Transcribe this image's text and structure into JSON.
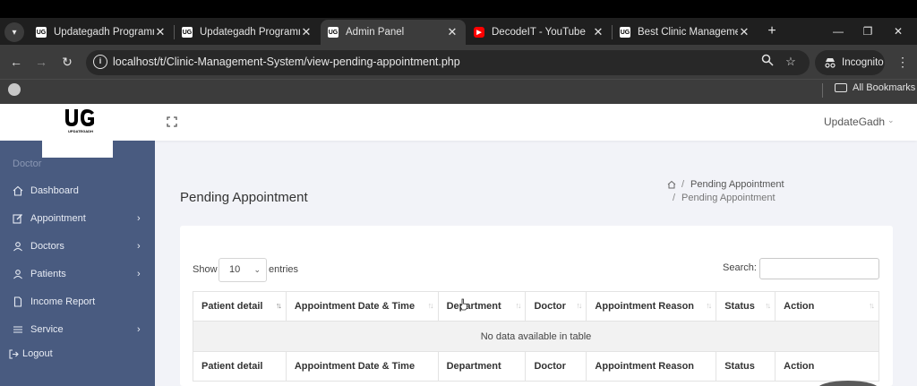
{
  "browser": {
    "tabs": [
      {
        "title": "Updategadh Programmin",
        "favicon": "UG",
        "active": false
      },
      {
        "title": "Updategadh Programmin",
        "favicon": "UG",
        "active": false
      },
      {
        "title": "Admin Panel",
        "favicon": "UG",
        "active": true
      },
      {
        "title": "DecodeIT - YouTube",
        "favicon": "youtube-icon",
        "active": false
      },
      {
        "title": "Best Clinic Management",
        "favicon": "UG",
        "active": false
      }
    ],
    "url": "localhost/t/Clinic-Management-System/view-pending-appointment.php",
    "incognito_label": "Incognito",
    "bookmarks_label": "All Bookmarks"
  },
  "app": {
    "logo_text": "UG",
    "logo_sub": "UPDATEGADH",
    "user_name": "UpdateGadh"
  },
  "sidebar": {
    "heading": "Doctor",
    "items": [
      {
        "label": "Dashboard",
        "icon": "home-icon",
        "has_submenu": false
      },
      {
        "label": "Appointment",
        "icon": "edit-icon",
        "has_submenu": true
      },
      {
        "label": "Doctors",
        "icon": "user-icon",
        "has_submenu": true
      },
      {
        "label": "Patients",
        "icon": "user-icon",
        "has_submenu": true
      },
      {
        "label": "Income Report",
        "icon": "file-icon",
        "has_submenu": false
      },
      {
        "label": "Service",
        "icon": "list-icon",
        "has_submenu": true
      }
    ],
    "logout_label": "Logout"
  },
  "main": {
    "title": "Pending Appointment",
    "breadcrumb": {
      "current": "Pending Appointment",
      "second": "Pending Appointment"
    },
    "table_controls": {
      "show_label": "Show",
      "page_size": "10",
      "entries_label": "entries",
      "search_label": "Search:"
    },
    "columns": [
      "Patient detail",
      "Appointment Date & Time",
      "Department",
      "Doctor",
      "Appointment Reason",
      "Status",
      "Action"
    ],
    "empty_message": "No data available in table"
  },
  "colors": {
    "sidebar_bg": "#495b80",
    "page_bg": "#f2f3f8",
    "browser_toolbar": "#3c3c3c"
  }
}
